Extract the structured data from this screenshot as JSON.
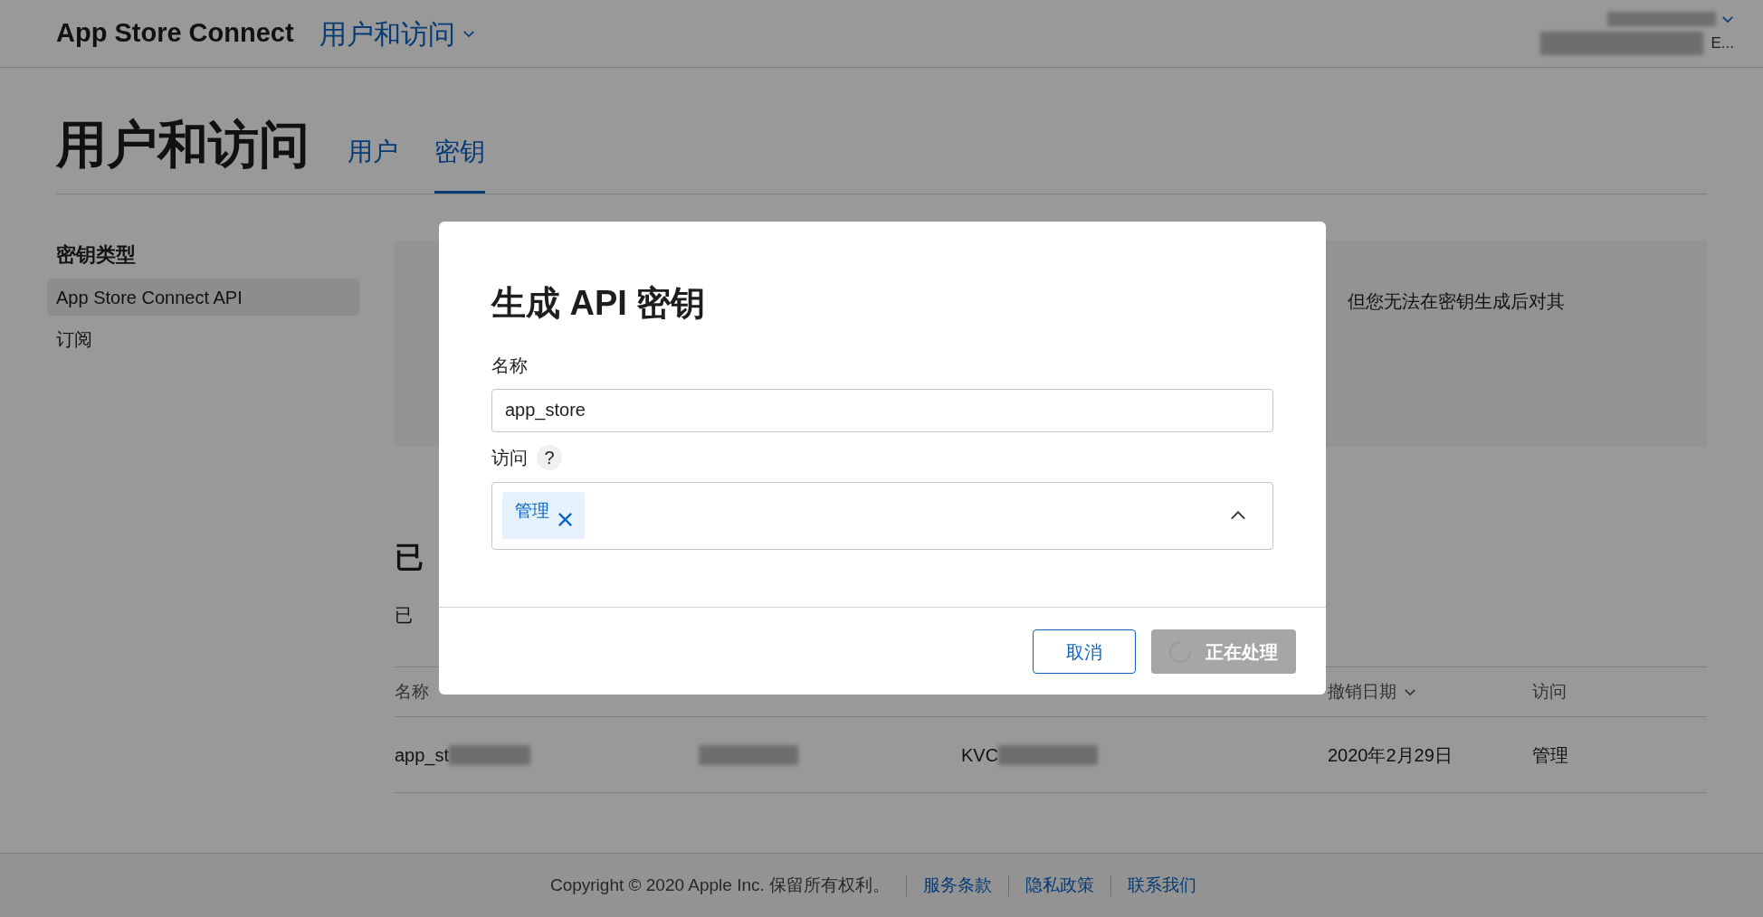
{
  "header": {
    "app_title": "App Store Connect",
    "nav_menu": "用户和访问",
    "account_text": "E..."
  },
  "page": {
    "title": "用户和访问",
    "tabs": [
      {
        "label": "用户",
        "selected": false
      },
      {
        "label": "密钥",
        "selected": true
      }
    ]
  },
  "sidebar": {
    "heading": "密钥类型",
    "items": [
      {
        "label": "App Store Connect API",
        "selected": true
      },
      {
        "label": "订阅",
        "selected": false
      }
    ]
  },
  "info_panel": {
    "text": "但您无法在密钥生成后对其"
  },
  "revoked": {
    "heading": "已",
    "description": "已",
    "columns": [
      {
        "label": "名称",
        "sorted": false
      },
      {
        "label": "撤销日期",
        "sorted": true
      },
      {
        "label": "访问",
        "sorted": false
      }
    ],
    "rows": [
      {
        "name": "app_st",
        "key_id": "KVC",
        "date": "2020年2月29日",
        "access": "管理"
      }
    ]
  },
  "dialog": {
    "title": "生成 API 密钥",
    "name_label": "名称",
    "name_value": "app_store",
    "access_label": "访问",
    "help": "?",
    "access_tags": [
      {
        "label": "管理"
      }
    ],
    "expanded": true,
    "buttons": [
      {
        "label": "取消",
        "kind": "secondary",
        "disabled": false
      },
      {
        "label": "正在处理",
        "kind": "busy",
        "disabled": true
      }
    ]
  },
  "footer": {
    "copyright": "Copyright © 2020 Apple Inc. 保留所有权利。",
    "links": [
      "服务条款",
      "隐私政策",
      "联系我们"
    ]
  }
}
